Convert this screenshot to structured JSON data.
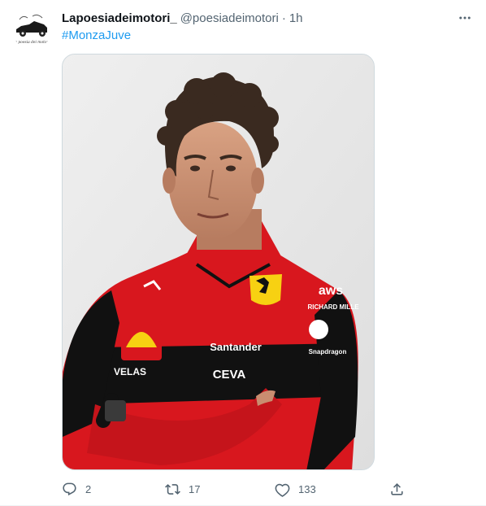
{
  "tweet": {
    "author_name": "Lapoesiadeimotori_",
    "author_handle": "@poesiadeimotori",
    "separator": "·",
    "timestamp": "1h",
    "text": "#MonzaJuve",
    "avatar_caption": "la poesia dei motori",
    "media": {
      "description": "Man with curly hair wearing Ferrari team jacket",
      "sponsor_texts": [
        "Santander",
        "VELAS",
        "CEVA",
        "aws",
        "RICHARD MILLE",
        "Snapdragon"
      ]
    },
    "stats": {
      "replies": "2",
      "retweets": "17",
      "likes": "133"
    }
  },
  "icons": {
    "more": "more-dots-icon",
    "reply": "reply-icon",
    "retweet": "retweet-icon",
    "like": "heart-icon",
    "share": "share-icon"
  },
  "colors": {
    "link": "#1d9bf0",
    "secondary_text": "#536471",
    "ferrari_red": "#d8171e"
  }
}
